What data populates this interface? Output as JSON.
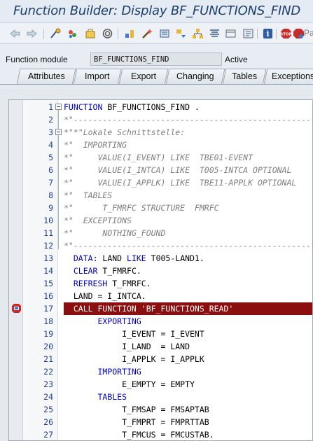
{
  "window": {
    "title": "Function Builder: Display BF_FUNCTIONS_FIND"
  },
  "toolbar": {
    "buttons": [
      "back-arrow-icon",
      "forward-arrow-icon",
      "other-object-icon",
      "display-change-icon",
      "active-inactive-icon",
      "where-used-icon",
      "check-icon",
      "activate-icon",
      "test-icon",
      "object-list-icon",
      "navigation-window-icon",
      "pretty-printer-icon",
      "info-icon",
      "stop-icon",
      "session-breakpoint-icon",
      "external-breakpoint-icon"
    ],
    "overflow_text": "Pa"
  },
  "header": {
    "function_module_label": "Function module",
    "function_module_value": "BF_FUNCTIONS_FIND",
    "status": "Active"
  },
  "tabs": [
    "Attributes",
    "Import",
    "Export",
    "Changing",
    "Tables",
    "Exceptions"
  ],
  "active_tab": "Source code",
  "colors": {
    "highlight": "#8b0f0f",
    "keyword": "#0000c8",
    "comment": "#808080",
    "line_number": "#1f3fa0"
  },
  "code": {
    "lines": [
      {
        "n": "1",
        "t": "FUNCTION BF_FUNCTIONS_FIND ."
      },
      {
        "n": "2",
        "t": "*\"----------------------------------------------------------------------"
      },
      {
        "n": "3",
        "t": "*\"*\"Lokale Schnittstelle:"
      },
      {
        "n": "4",
        "t": "*\"  IMPORTING"
      },
      {
        "n": "5",
        "t": "*\"     VALUE(I_EVENT) LIKE  TBE01-EVENT"
      },
      {
        "n": "6",
        "t": "*\"     VALUE(I_INTCA) LIKE  T005-INTCA OPTIONAL"
      },
      {
        "n": "7",
        "t": "*\"     VALUE(I_APPLK) LIKE  TBE11-APPLK OPTIONAL"
      },
      {
        "n": "8",
        "t": "*\"  TABLES"
      },
      {
        "n": "9",
        "t": "*\"      T_FMRFC STRUCTURE  FMRFC"
      },
      {
        "n": "10",
        "t": "*\"  EXCEPTIONS"
      },
      {
        "n": "11",
        "t": "*\"      NOTHING_FOUND"
      },
      {
        "n": "12",
        "t": "*\"----------------------------------------------------------------------"
      },
      {
        "n": "13",
        "t": "  DATA: LAND LIKE T005-LAND1."
      },
      {
        "n": "14",
        "t": "  CLEAR T_FMRFC."
      },
      {
        "n": "15",
        "t": "  REFRESH T_FMRFC."
      },
      {
        "n": "16",
        "t": "  LAND = I_INTCA."
      },
      {
        "n": "17",
        "t": "  CALL FUNCTION 'BF_FUNCTIONS_READ'"
      },
      {
        "n": "18",
        "t": "       EXPORTING"
      },
      {
        "n": "19",
        "t": "            I_EVENT = I_EVENT"
      },
      {
        "n": "20",
        "t": "            I_LAND  = LAND"
      },
      {
        "n": "21",
        "t": "            I_APPLK = I_APPLK"
      },
      {
        "n": "22",
        "t": "       IMPORTING"
      },
      {
        "n": "23",
        "t": "            E_EMPTY = EMPTY"
      },
      {
        "n": "24",
        "t": "       TABLES"
      },
      {
        "n": "25",
        "t": "            T_FMSAP = FMSAPTAB"
      },
      {
        "n": "26",
        "t": "            T_FMPRT = FMPRTTAB"
      },
      {
        "n": "27",
        "t": "            T_FMCUS = FMCUSTAB."
      }
    ]
  }
}
